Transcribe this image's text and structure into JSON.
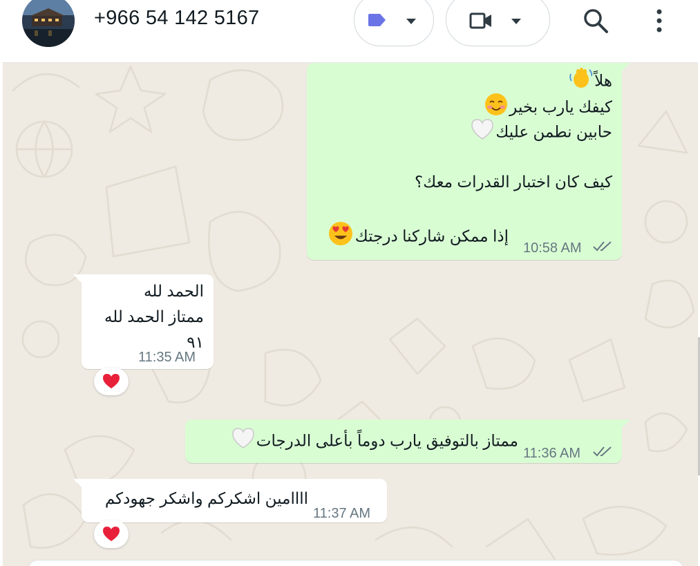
{
  "header": {
    "contact_name": "+966 54 142 5167"
  },
  "icons": {
    "avatar": "contact-photo",
    "labels": "label-tag-icon",
    "video": "video-camera-icon",
    "dropdown": "chevron-down-icon",
    "search": "search-icon",
    "menu": "more-vertical-icon",
    "read": "double-check-icon",
    "reaction": "red-heart-icon"
  },
  "colors": {
    "outgoing_bubble": "#d9fdd3",
    "incoming_bubble": "#ffffff",
    "chat_background": "#efeae2",
    "label_tag": "#6b74e6",
    "meta_text": "#667781"
  },
  "messages": [
    {
      "direction": "outgoing",
      "lines": [
        "هلاً",
        "كيفك يارب بخير",
        "حابين نطمن عليك",
        "",
        "كيف كان اختبار القدرات معك؟",
        "إذا ممكن شاركنا درجتك"
      ],
      "time": "10:58 AM",
      "status": "read"
    },
    {
      "direction": "incoming",
      "lines": [
        "الحمد لله",
        "ممتاز الحمد لله",
        "٩١"
      ],
      "time": "11:35 AM",
      "reaction": "❤️"
    },
    {
      "direction": "outgoing",
      "lines": [
        "ممتاز بالتوفيق يارب دوماً بأعلى الدرجات"
      ],
      "time": "11:36 AM",
      "status": "read"
    },
    {
      "direction": "incoming",
      "lines": [
        "اااامين اشكركم واشكر جهودكم"
      ],
      "time": "11:37 AM",
      "reaction": "❤️"
    }
  ]
}
